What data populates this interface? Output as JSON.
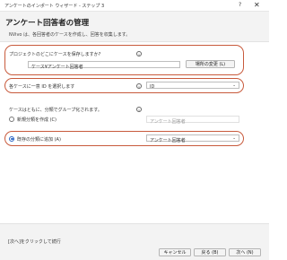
{
  "window": {
    "title": "アンケートのインポート ウィザード - ステップ 3",
    "help_glyph": "?",
    "close_glyph": "✕"
  },
  "header": {
    "heading": "アンケート回答者の管理",
    "description": "NVivo は、各回答者のケースを作成し、回答を収集します。"
  },
  "location": {
    "label": "プロジェクトのどこにケースを保存しますか?",
    "value": "ケース¥アンケート回答者",
    "change_button": "場所の変更 (L)"
  },
  "unique_id": {
    "label": "各ケースに一意 ID を選択します",
    "selected": "ID"
  },
  "grouping": {
    "label": "ケースはともに、分類でグループ化されます。",
    "options": [
      {
        "label": "新規分類を作成 (C)",
        "value": "アンケート回答者",
        "selected": false,
        "enabled": false
      },
      {
        "label": "既存の分類に追加 (A)",
        "value": "アンケート回答者",
        "selected": true,
        "enabled": true
      }
    ]
  },
  "footer": {
    "hint": "[次へ]をクリックして続行",
    "cancel": "キャンセル",
    "back": "戻る (B)",
    "next": "次へ (N)"
  },
  "colors": {
    "highlight": "#c85a3c",
    "radio_selected": "#2b66c4",
    "header_bg": "#f3f3f3"
  },
  "icons": {
    "info": "info-icon",
    "dropdown": "chevron-down-icon"
  }
}
